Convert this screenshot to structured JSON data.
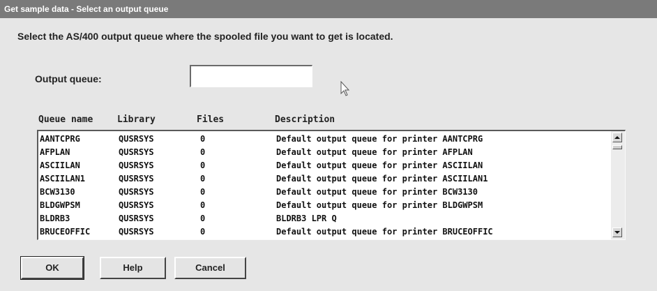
{
  "window": {
    "title": "Get sample data - Select an output queue"
  },
  "instructions": "Select the AS/400 output queue where the spooled file you want to get is located.",
  "output_queue": {
    "label": "Output queue:",
    "value": ""
  },
  "columns": [
    "Queue name",
    "Library",
    "Files",
    "Description"
  ],
  "rows": [
    {
      "name": "AANTCPRG",
      "library": "QUSRSYS",
      "files": "0",
      "description": "Default output queue for printer AANTCPRG"
    },
    {
      "name": "AFPLAN",
      "library": "QUSRSYS",
      "files": "0",
      "description": "Default output queue for printer AFPLAN"
    },
    {
      "name": "ASCIILAN",
      "library": "QUSRSYS",
      "files": "0",
      "description": "Default output queue for printer ASCIILAN"
    },
    {
      "name": "ASCIILAN1",
      "library": "QUSRSYS",
      "files": "0",
      "description": "Default output queue for printer ASCIILAN1"
    },
    {
      "name": "BCW3130",
      "library": "QUSRSYS",
      "files": "0",
      "description": "Default output queue for printer BCW3130"
    },
    {
      "name": "BLDGWPSM",
      "library": "QUSRSYS",
      "files": "0",
      "description": "Default output queue for printer BLDGWPSM"
    },
    {
      "name": "BLDRB3",
      "library": "QUSRSYS",
      "files": "0",
      "description": "BLDRB3 LPR Q"
    },
    {
      "name": "BRUCEOFFIC",
      "library": "QUSRSYS",
      "files": "0",
      "description": "Default output queue for printer BRUCEOFFIC"
    }
  ],
  "buttons": {
    "ok": "OK",
    "help": "Help",
    "cancel": "Cancel"
  },
  "colors": {
    "titlebar": "#7a7a7a",
    "dialog_bg": "#e6e6e6"
  }
}
